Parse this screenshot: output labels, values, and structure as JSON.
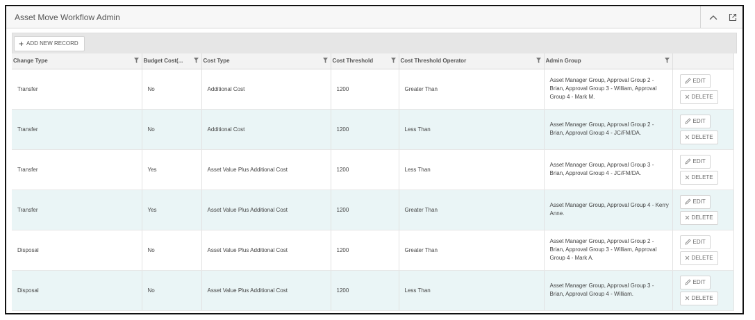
{
  "window": {
    "title": "Asset Move Workflow Admin"
  },
  "toolbar": {
    "add_label": "ADD NEW RECORD"
  },
  "columns": [
    "Change Type",
    "Budget Cost(...",
    "Cost Type",
    "Cost Threshold",
    "Cost Threshold Operator",
    "Admin Group"
  ],
  "rows": [
    {
      "change_type": "Transfer",
      "budget_cost": "No",
      "cost_type": "Additional Cost",
      "threshold": "1200",
      "operator": "Greater Than",
      "admin_group": "Asset Manager Group, Approval Group 2 - Brian, Approval Group 3 - William, Approval Group 4 - Mark M."
    },
    {
      "change_type": "Transfer",
      "budget_cost": "No",
      "cost_type": "Additional Cost",
      "threshold": "1200",
      "operator": "Less Than",
      "admin_group": "Asset Manager Group, Approval Group 2 - Brian, Approval Group 4 - JC/FM/DA."
    },
    {
      "change_type": "Transfer",
      "budget_cost": "Yes",
      "cost_type": "Asset Value Plus Additional Cost",
      "threshold": "1200",
      "operator": "Less Than",
      "admin_group": "Asset Manager Group, Approval Group 3 - Brian, Approval Group 4 - JC/FM/DA."
    },
    {
      "change_type": "Transfer",
      "budget_cost": "Yes",
      "cost_type": "Asset Value Plus Additional Cost",
      "threshold": "1200",
      "operator": "Greater Than",
      "admin_group": "Asset Manager Group, Approval Group 4 - Kerry Anne."
    },
    {
      "change_type": "Disposal",
      "budget_cost": "No",
      "cost_type": "Asset Value Plus Additional Cost",
      "threshold": "1200",
      "operator": "Greater Than",
      "admin_group": "Asset Manager Group, Approval Group 2 - Brian, Approval Group 3 - William, Approval Group 4 - Mark A."
    },
    {
      "change_type": "Disposal",
      "budget_cost": "No",
      "cost_type": "Asset Value Plus Additional Cost",
      "threshold": "1200",
      "operator": "Less Than",
      "admin_group": "Asset Manager Group, Approval Group 3 - Brian, Approval Group 4 - William."
    }
  ],
  "actions": {
    "edit_label": "EDIT",
    "delete_label": "DELETE"
  },
  "icons": {
    "collapse": "chevron-up-icon",
    "popout": "external-link-icon",
    "filter": "filter-icon",
    "add": "plus-icon",
    "edit": "pencil-icon",
    "delete": "x-icon"
  },
  "colors": {
    "row_alt": "#eaf5f6",
    "header_bg": "#f3f3f3",
    "toolbar_bg": "#e6e6e6"
  }
}
